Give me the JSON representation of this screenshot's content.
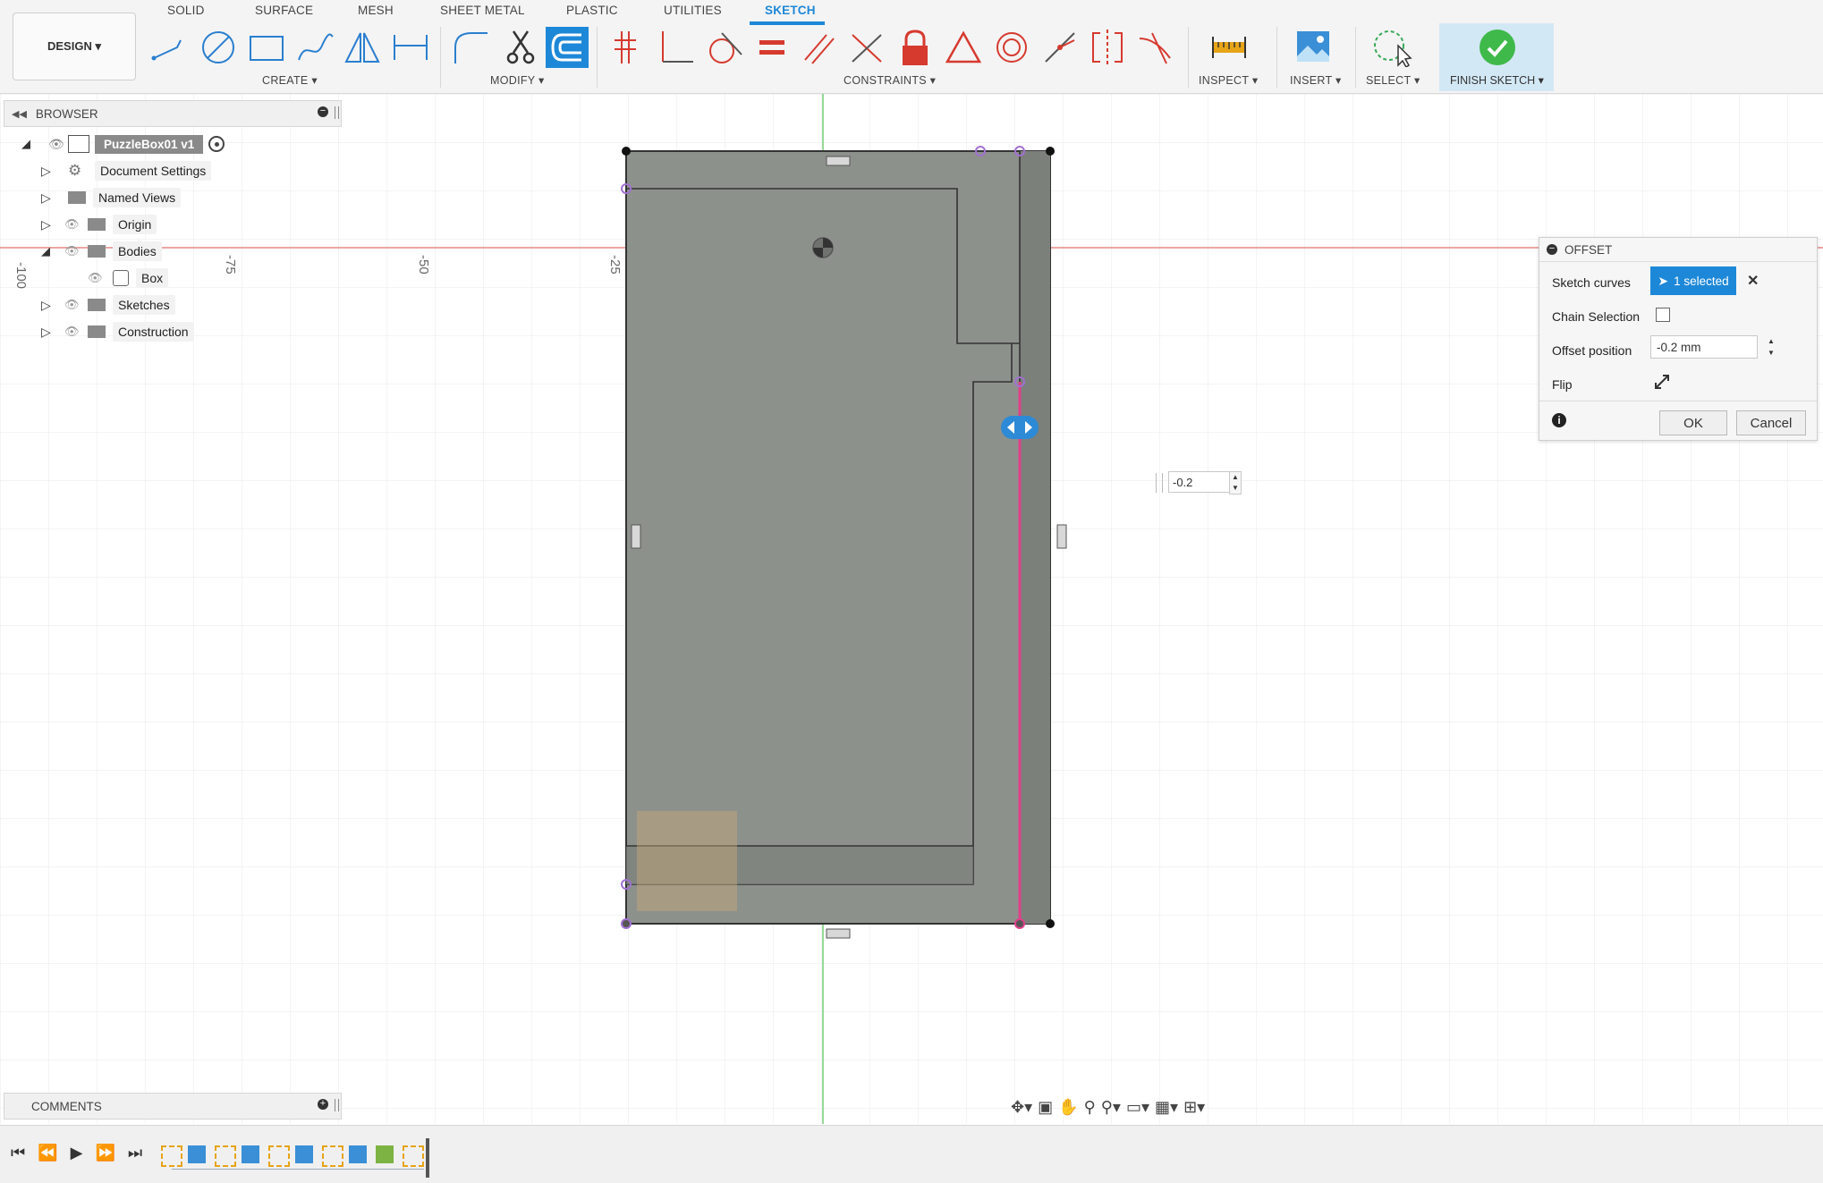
{
  "tabs": [
    "SOLID",
    "SURFACE",
    "MESH",
    "SHEET METAL",
    "PLASTIC",
    "UTILITIES",
    "SKETCH"
  ],
  "active_tab": "SKETCH",
  "workspace": {
    "label": "DESIGN ▾"
  },
  "groups": {
    "create": "CREATE ▾",
    "modify": "MODIFY ▾",
    "constraints": "CONSTRAINTS ▾",
    "inspect": "INSPECT ▾",
    "insert": "INSERT ▾",
    "select": "SELECT ▾",
    "finish": "FINISH SKETCH ▾"
  },
  "browser": {
    "title": "BROWSER",
    "root": "PuzzleBox01 v1",
    "items": [
      "Document Settings",
      "Named Views",
      "Origin",
      "Bodies",
      "Box",
      "Sketches",
      "Construction"
    ]
  },
  "ruler": [
    "-100",
    "-75",
    "-50",
    "-25"
  ],
  "offset": {
    "title": "OFFSET",
    "sketch_curves_label": "Sketch curves",
    "sketch_curves_value": "1 selected",
    "chain_label": "Chain Selection",
    "position_label": "Offset position",
    "position_value": "-0.2 mm",
    "flip_label": "Flip",
    "ok": "OK",
    "cancel": "Cancel"
  },
  "inline_input": "-0.2",
  "comments": {
    "title": "COMMENTS"
  },
  "colors": {
    "accent": "#1e88d8",
    "finish_bg": "#d3e8f5",
    "sketch_fill": "#8d918c",
    "selected_line": "#e0408a"
  }
}
